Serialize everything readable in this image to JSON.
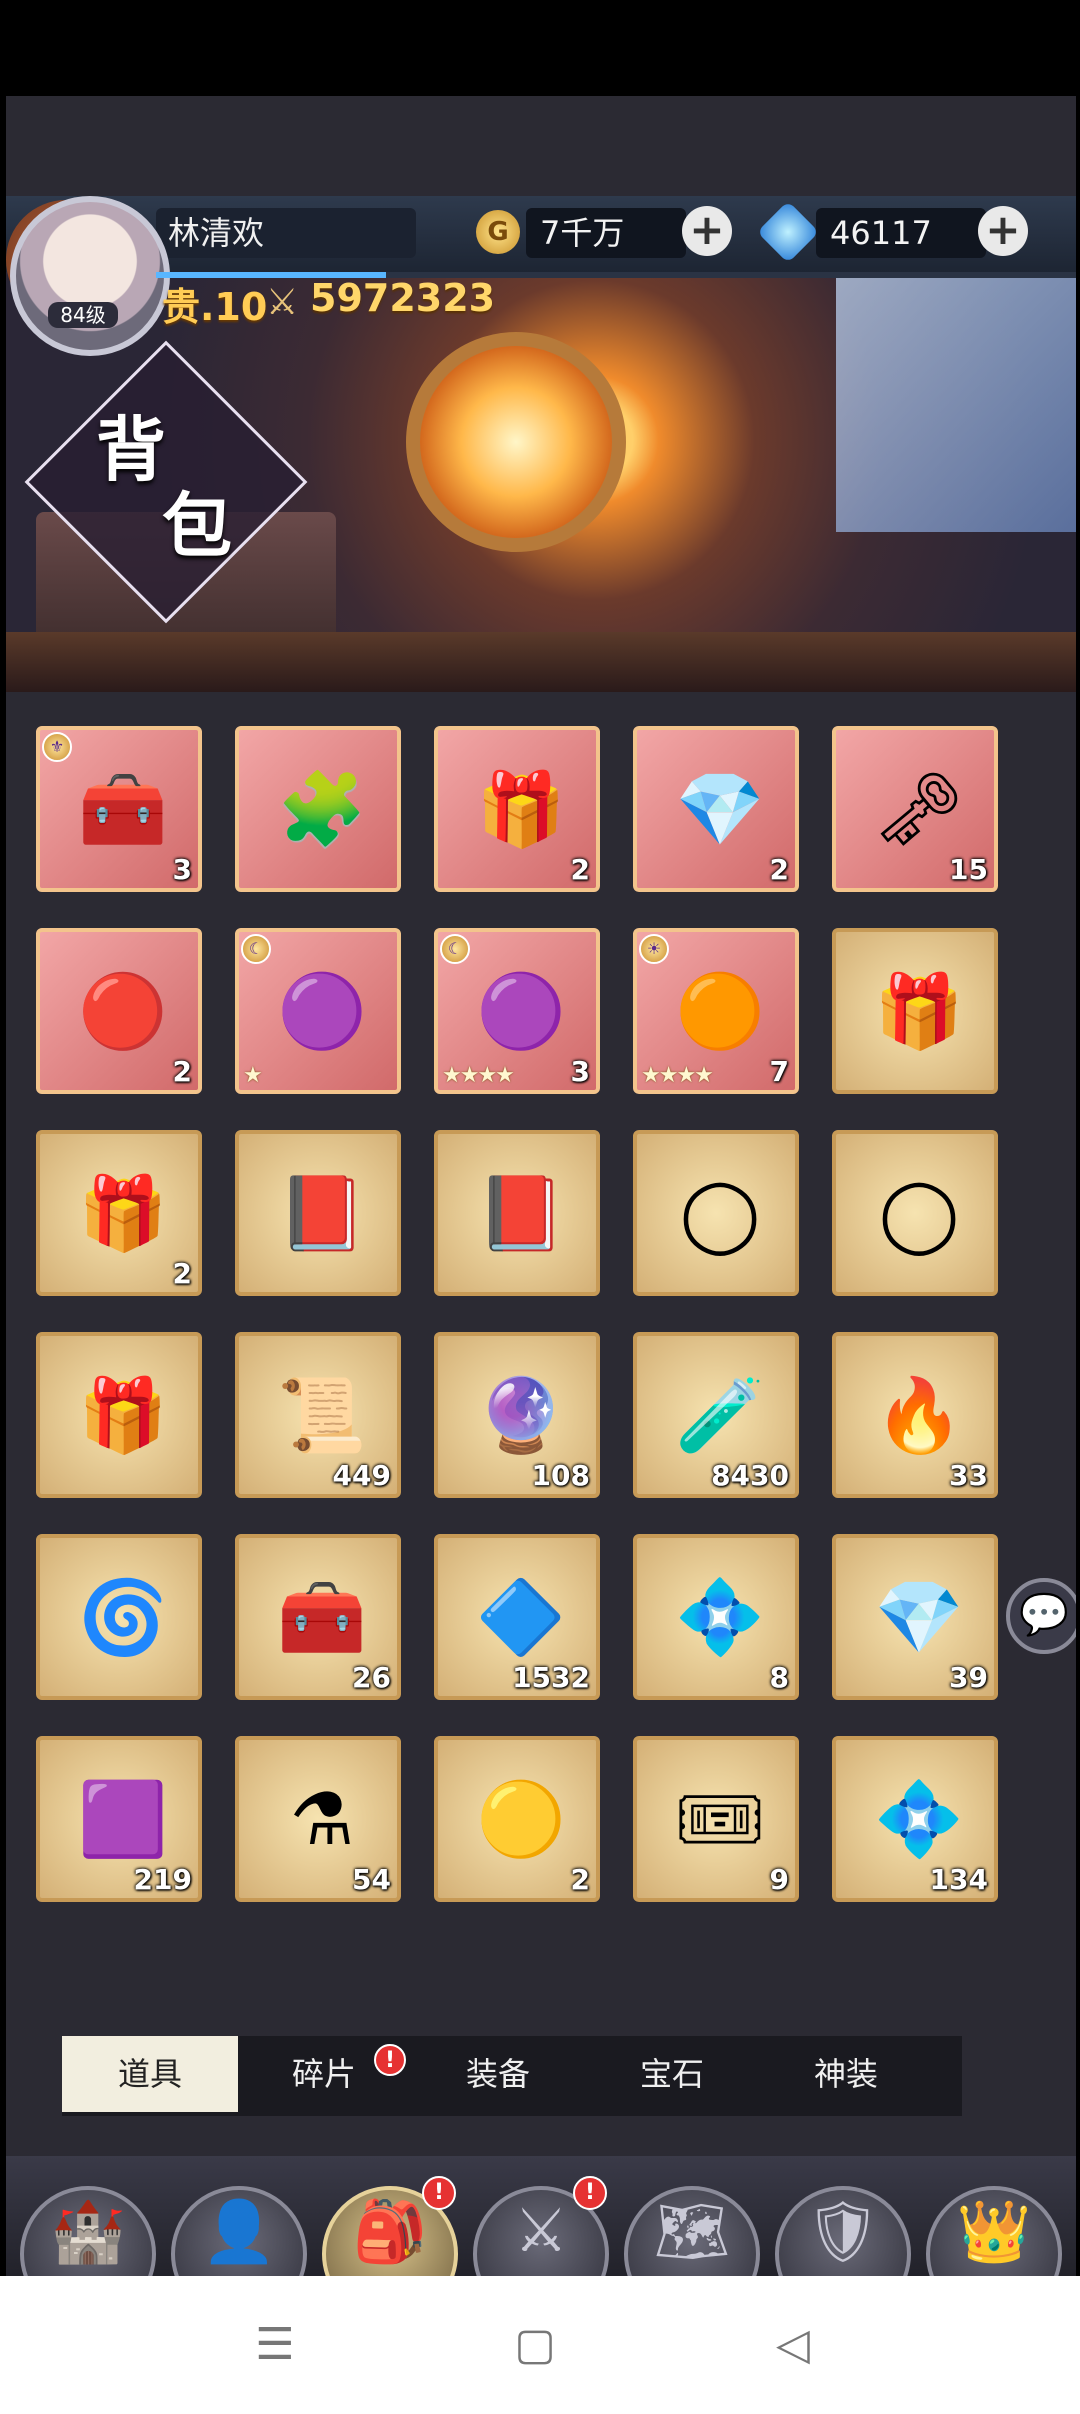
{
  "header": {
    "player_name": "林清欢",
    "avatar_level": "84级",
    "vip_label": "贵.10",
    "power": "5972323",
    "gold": "7千万",
    "gems": "46117",
    "xp_progress": 0.25
  },
  "banner": {
    "title_line1": "背",
    "title_line2": "包"
  },
  "items": [
    [
      {
        "icon": "card-chest-icon",
        "glyph": "🧰",
        "style": "red",
        "count": "3",
        "tag": "⚜"
      },
      {
        "icon": "hero-portrait-puzzle-icon",
        "glyph": "🧩",
        "style": "red",
        "count": ""
      },
      {
        "icon": "mystery-box-icon",
        "glyph": "🎁",
        "style": "red",
        "count": "2"
      },
      {
        "icon": "rainbow-crystal-icon",
        "glyph": "💎",
        "style": "red",
        "count": "2"
      },
      {
        "icon": "golden-key-icon",
        "glyph": "🗝",
        "style": "red",
        "count": "15"
      }
    ],
    [
      {
        "icon": "red-gem-icon",
        "glyph": "🔴",
        "style": "red",
        "count": "2"
      },
      {
        "icon": "purple-medallion-icon",
        "glyph": "🟣",
        "style": "red",
        "count": "",
        "stars": "★",
        "tag": "☾"
      },
      {
        "icon": "purple-medallion-icon",
        "glyph": "🟣",
        "style": "red",
        "count": "3",
        "stars": "★★★★",
        "tag": "☾"
      },
      {
        "icon": "gold-medallion-icon",
        "glyph": "🟠",
        "style": "red",
        "count": "7",
        "stars": "★★★★",
        "tag": "☀"
      },
      {
        "icon": "crystal-gift-box-icon",
        "glyph": "🎁",
        "style": "gold",
        "count": ""
      }
    ],
    [
      {
        "icon": "mystery-box-icon",
        "glyph": "🎁",
        "style": "gold",
        "count": "2"
      },
      {
        "icon": "title-book-icon",
        "glyph": "📕",
        "style": "gold",
        "count": ""
      },
      {
        "icon": "title-book-icon",
        "glyph": "📕",
        "style": "gold",
        "count": ""
      },
      {
        "icon": "silver-frame-icon",
        "glyph": "◯",
        "style": "gold",
        "count": ""
      },
      {
        "icon": "laurel-frame-icon",
        "glyph": "◯",
        "style": "gold",
        "count": ""
      }
    ],
    [
      {
        "icon": "gift-box-icon",
        "glyph": "🎁",
        "style": "gold",
        "count": ""
      },
      {
        "icon": "scroll-icon",
        "glyph": "📜",
        "style": "gold",
        "count": "449"
      },
      {
        "icon": "blue-ore-icon",
        "glyph": "🔮",
        "style": "gold",
        "count": "108"
      },
      {
        "icon": "potion-vial-icon",
        "glyph": "🧪",
        "style": "gold",
        "count": "8430"
      },
      {
        "icon": "fire-ore-icon",
        "glyph": "🔥",
        "style": "gold",
        "count": "33"
      }
    ],
    [
      {
        "icon": "blue-stone-icon",
        "glyph": "🌀",
        "style": "gold",
        "count": ""
      },
      {
        "icon": "treasure-chest-icon",
        "glyph": "🧰",
        "style": "gold",
        "count": "26"
      },
      {
        "icon": "blue-diamond-icon",
        "glyph": "🔷",
        "style": "gold",
        "count": "1532"
      },
      {
        "icon": "crystal-pendant-icon",
        "glyph": "💠",
        "style": "gold",
        "count": "8"
      },
      {
        "icon": "prism-crystal-icon",
        "glyph": "💎",
        "style": "gold",
        "count": "39"
      }
    ],
    [
      {
        "icon": "magic-cube-icon",
        "glyph": "🟪",
        "style": "gold",
        "count": "219"
      },
      {
        "icon": "golden-potion-icon",
        "glyph": "⚗",
        "style": "gold",
        "count": "54"
      },
      {
        "icon": "amber-stone-icon",
        "glyph": "🟡",
        "style": "gold",
        "count": "2"
      },
      {
        "icon": "ticket-icon",
        "glyph": "🎟",
        "style": "gold",
        "count": "9"
      },
      {
        "icon": "rainbow-gem-icon",
        "glyph": "💠",
        "style": "gold",
        "count": "134"
      }
    ]
  ],
  "tabs": [
    {
      "label": "道具",
      "active": true,
      "badge": ""
    },
    {
      "label": "碎片",
      "active": false,
      "badge": "!"
    },
    {
      "label": "装备",
      "active": false,
      "badge": ""
    },
    {
      "label": "宝石",
      "active": false,
      "badge": ""
    },
    {
      "label": "神装",
      "active": false,
      "badge": ""
    }
  ],
  "nav": [
    {
      "label": "主城",
      "icon": "castle-icon",
      "glyph": "🏰",
      "active": false,
      "badge": ""
    },
    {
      "label": "英雄",
      "icon": "hooded-hero-icon",
      "glyph": "👤",
      "active": false,
      "badge": ""
    },
    {
      "label": "背包",
      "icon": "backpack-icon",
      "glyph": "🎒",
      "active": true,
      "badge": "!"
    },
    {
      "label": "战斗",
      "icon": "crossed-swords-icon",
      "glyph": "⚔",
      "active": false,
      "badge": "!"
    },
    {
      "label": "历练",
      "icon": "map-icon",
      "glyph": "🗺",
      "active": false,
      "badge": ""
    },
    {
      "label": "公会",
      "icon": "shield-cross-icon",
      "glyph": "🛡",
      "active": false,
      "badge": ""
    },
    {
      "label": "女神",
      "icon": "goddess-icon",
      "glyph": "👑",
      "active": false,
      "badge": ""
    }
  ],
  "chat_glyph": "💬",
  "system_nav": {
    "menu": "☰",
    "home": "▢",
    "back": "◁"
  }
}
